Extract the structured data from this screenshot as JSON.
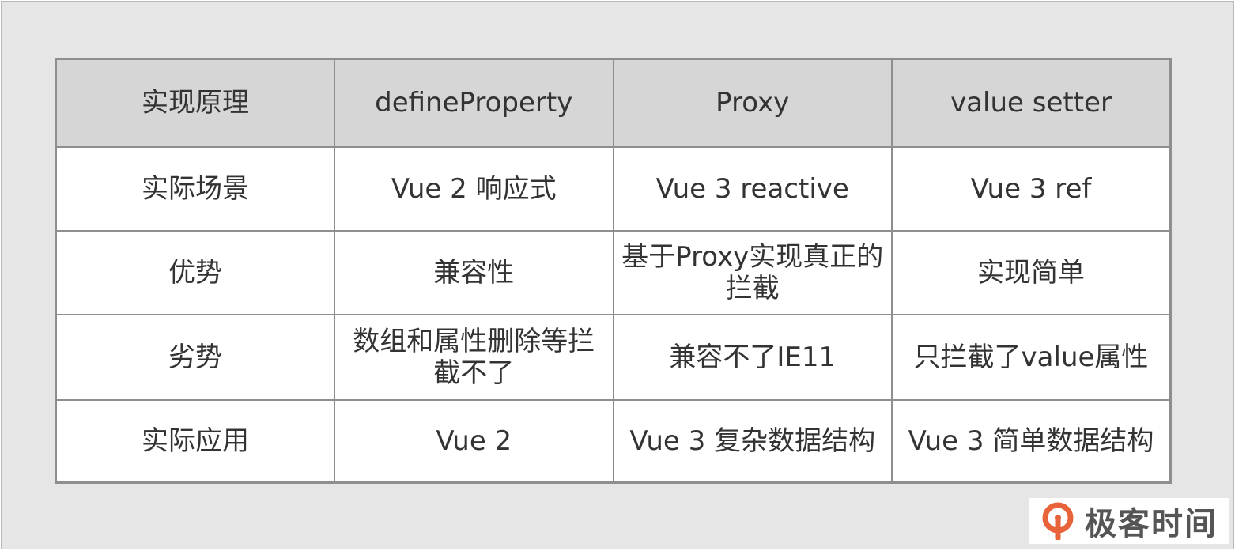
{
  "table": {
    "header": [
      "实现原理",
      "defineProperty",
      "Proxy",
      "value setter"
    ],
    "rows": [
      [
        "实际场景",
        "Vue 2 响应式",
        "Vue 3 reactive",
        "Vue 3 ref"
      ],
      [
        "优势",
        "兼容性",
        "基于Proxy实现真正的拦截",
        "实现简单"
      ],
      [
        "劣势",
        "数组和属性删除等拦截不了",
        "兼容不了IE11",
        "只拦截了value属性"
      ],
      [
        "实际应用",
        "Vue 2",
        "Vue 3 复杂数据结构",
        "Vue 3 简单数据结构"
      ]
    ]
  },
  "logo": {
    "text": "极客时间",
    "icon": "geektime-logo-icon",
    "color": "#e8623a"
  }
}
